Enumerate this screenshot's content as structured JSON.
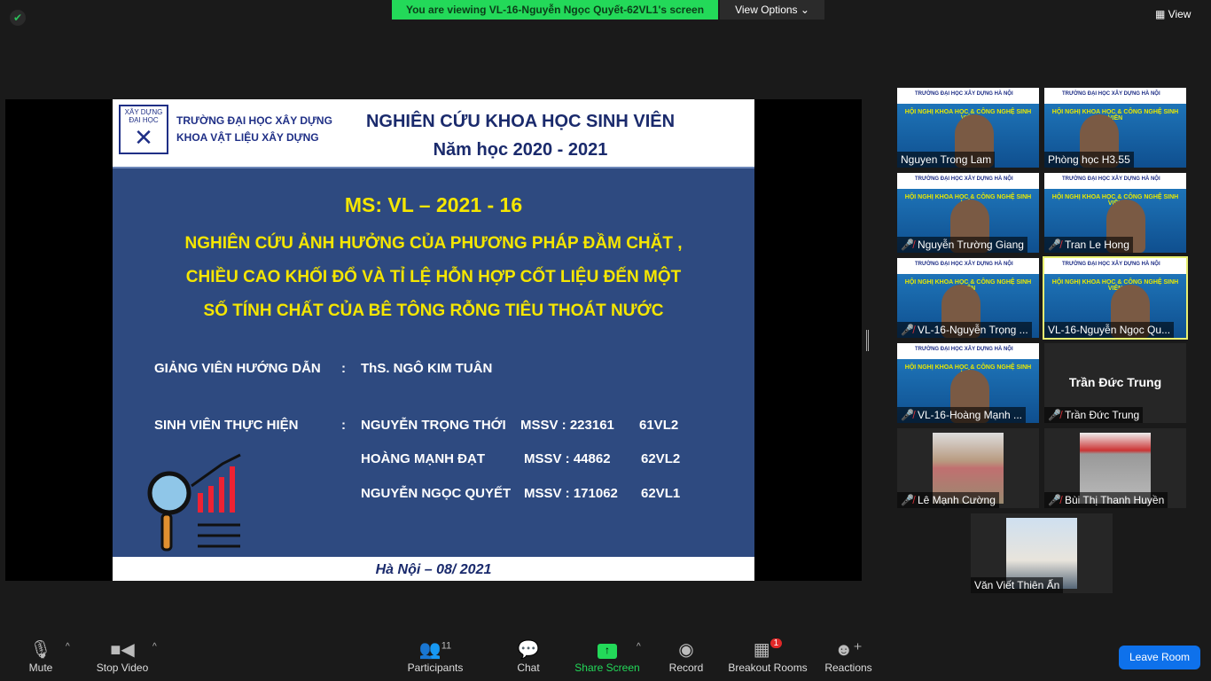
{
  "top": {
    "banner": "You are viewing VL-16-Nguyễn Ngọc Quyết-62VL1's screen",
    "view_options": "View Options ⌄",
    "view": "View"
  },
  "slide": {
    "logo_text": "XÂY DỰNG ĐẠI HỌC",
    "org_line1": "TRƯỜNG ĐẠI HỌC XÂY DỰNG",
    "org_line2": "KHOA VẬT LIỆU XÂY DỰNG",
    "title": "NGHIÊN CỨU KHOA HỌC SINH VIÊN",
    "year": "Năm học 2020 - 2021",
    "ms": "MS: VL – 2021 - 16",
    "topic": [
      "NGHIÊN CỨU ẢNH HƯỞNG CỦA PHƯƠNG PHÁP ĐẦM CHẶT ,",
      "CHIỀU CAO KHỐI ĐỔ VÀ TỈ LỆ HỖN HỢP CỐT LIỆU ĐẾN MỘT",
      "SỐ TÍNH CHẤT CỦA BÊ TÔNG RỖNG TIÊU THOÁT NƯỚC"
    ],
    "advisor_label": "GIẢNG VIÊN HƯỚNG DẪN",
    "advisor": "ThS. NGÔ KIM TUÂN",
    "students_label": "SINH VIÊN THỰC HIỆN",
    "colon": ":",
    "students": [
      {
        "name": "NGUYỄN TRỌNG THỚI",
        "mssv": "MSSV : 223161",
        "cls": "61VL2"
      },
      {
        "name": "HOÀNG MẠNH ĐẠT",
        "mssv": "MSSV : 44862",
        "cls": "62VL2"
      },
      {
        "name": "NGUYỄN NGỌC QUYẾT",
        "mssv": "MSSV : 171062",
        "cls": "62VL1"
      }
    ],
    "footer": "Hà Nội – 08/ 2021"
  },
  "tile_video": {
    "header": "TRƯỜNG ĐẠI HỌC XÂY DỰNG HÀ NỘI",
    "conf": "HỘI NGHỊ KHOA HỌC & CÔNG NGHỆ SINH VIÊN"
  },
  "participants": [
    {
      "name": "Nguyen Trong Lam",
      "muted": false
    },
    {
      "name": "Phòng học H3.55",
      "muted": false
    },
    {
      "name": "Nguyễn Trường Giang",
      "muted": true
    },
    {
      "name": "Tran Le Hong",
      "muted": true
    },
    {
      "name": "VL-16-Nguyễn Trọng ...",
      "muted": true
    },
    {
      "name": "VL-16-Nguyễn Ngọc Qu...",
      "muted": false
    },
    {
      "name": "VL-16-Hoàng Mạnh ...",
      "muted": true
    },
    {
      "name": "Trần Đức Trung",
      "muted": true
    },
    {
      "name": "Lê Mạnh Cường",
      "muted": true
    },
    {
      "name": "Bùi Thị Thanh Huyền",
      "muted": true
    },
    {
      "name": "Văn Viết Thiên Ấn",
      "muted": false
    }
  ],
  "toolbar": {
    "mute": "Mute",
    "stop_video": "Stop Video",
    "participants": "Participants",
    "participant_count": "11",
    "chat": "Chat",
    "share": "Share Screen",
    "record": "Record",
    "breakout": "Breakout Rooms",
    "breakout_badge": "1",
    "reactions": "Reactions",
    "leave": "Leave Room"
  },
  "colors": {
    "share_green": "#23d959",
    "leave_blue": "#0e71eb",
    "slide_blue": "#2e4a80",
    "slide_yellow": "#f5e600"
  }
}
